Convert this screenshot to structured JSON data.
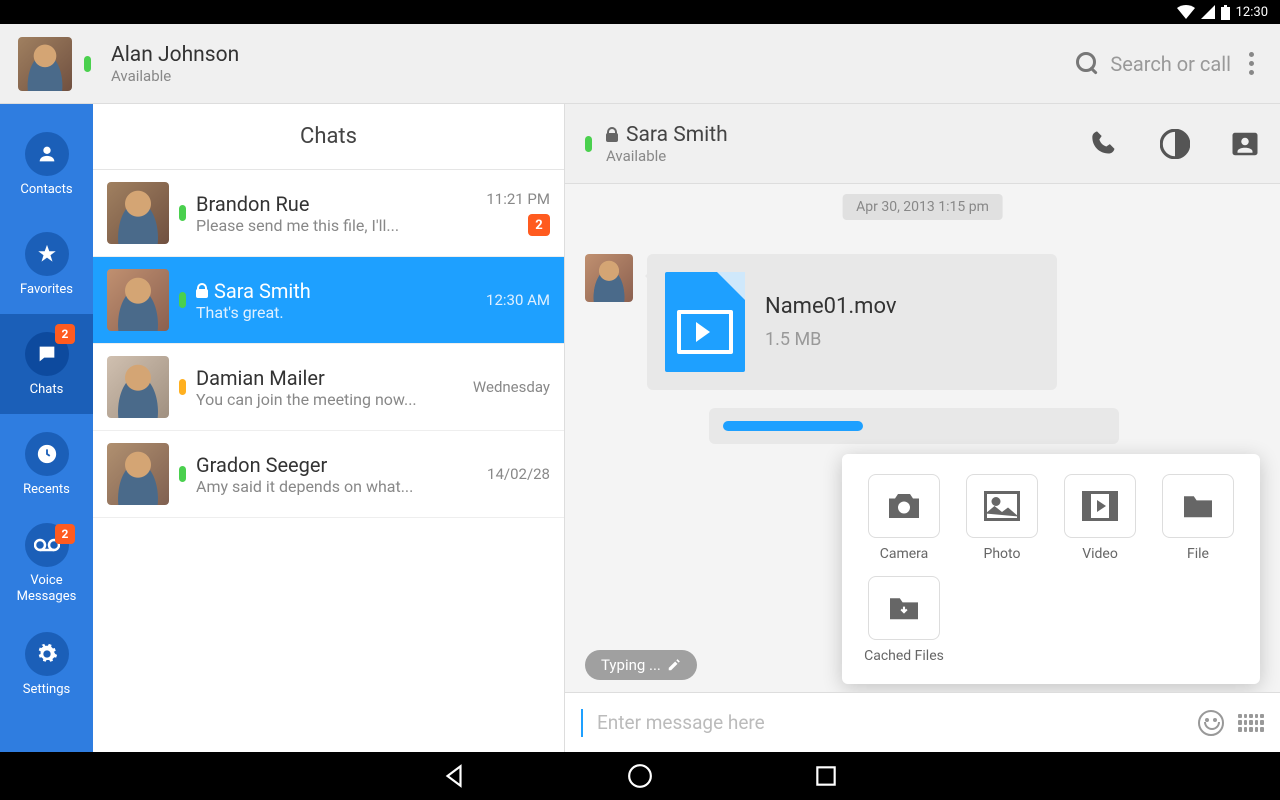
{
  "status_bar": {
    "time": "12:30"
  },
  "header": {
    "user_name": "Alan Johnson",
    "user_status": "Available",
    "search_placeholder": "Search or call"
  },
  "sidebar": {
    "items": [
      {
        "label": "Contacts",
        "badge": null
      },
      {
        "label": "Favorites",
        "badge": null
      },
      {
        "label": "Chats",
        "badge": "2"
      },
      {
        "label": "Recents",
        "badge": null
      },
      {
        "label": "Voice Messages",
        "badge": "2"
      },
      {
        "label": "Settings",
        "badge": null
      }
    ]
  },
  "chat_list": {
    "title": "Chats",
    "items": [
      {
        "name": "Brandon Rue",
        "preview": "Please send me this file, I'll...",
        "time": "11:21 PM",
        "badge": "2",
        "status": "online",
        "locked": false
      },
      {
        "name": "Sara Smith",
        "preview": "That's great.",
        "time": "12:30 AM",
        "badge": null,
        "status": "online",
        "locked": true
      },
      {
        "name": "Damian Mailer",
        "preview": "You can join the meeting now...",
        "time": "Wednesday",
        "badge": null,
        "status": "away",
        "locked": false
      },
      {
        "name": "Gradon Seeger",
        "preview": "Amy said it depends on what...",
        "time": "14/02/28",
        "badge": null,
        "status": "online",
        "locked": false
      }
    ]
  },
  "conversation": {
    "title": "Sara Smith",
    "subtitle": "Available",
    "date_label": "Apr 30, 2013 1:15 pm",
    "file": {
      "name": "Name01.mov",
      "size": "1.5 MB"
    },
    "typing_label": "Typing ...",
    "compose_placeholder": "Enter message here"
  },
  "attach_menu": {
    "items": [
      {
        "label": "Camera"
      },
      {
        "label": "Photo"
      },
      {
        "label": "Video"
      },
      {
        "label": "File"
      },
      {
        "label": "Cached Files"
      }
    ]
  }
}
